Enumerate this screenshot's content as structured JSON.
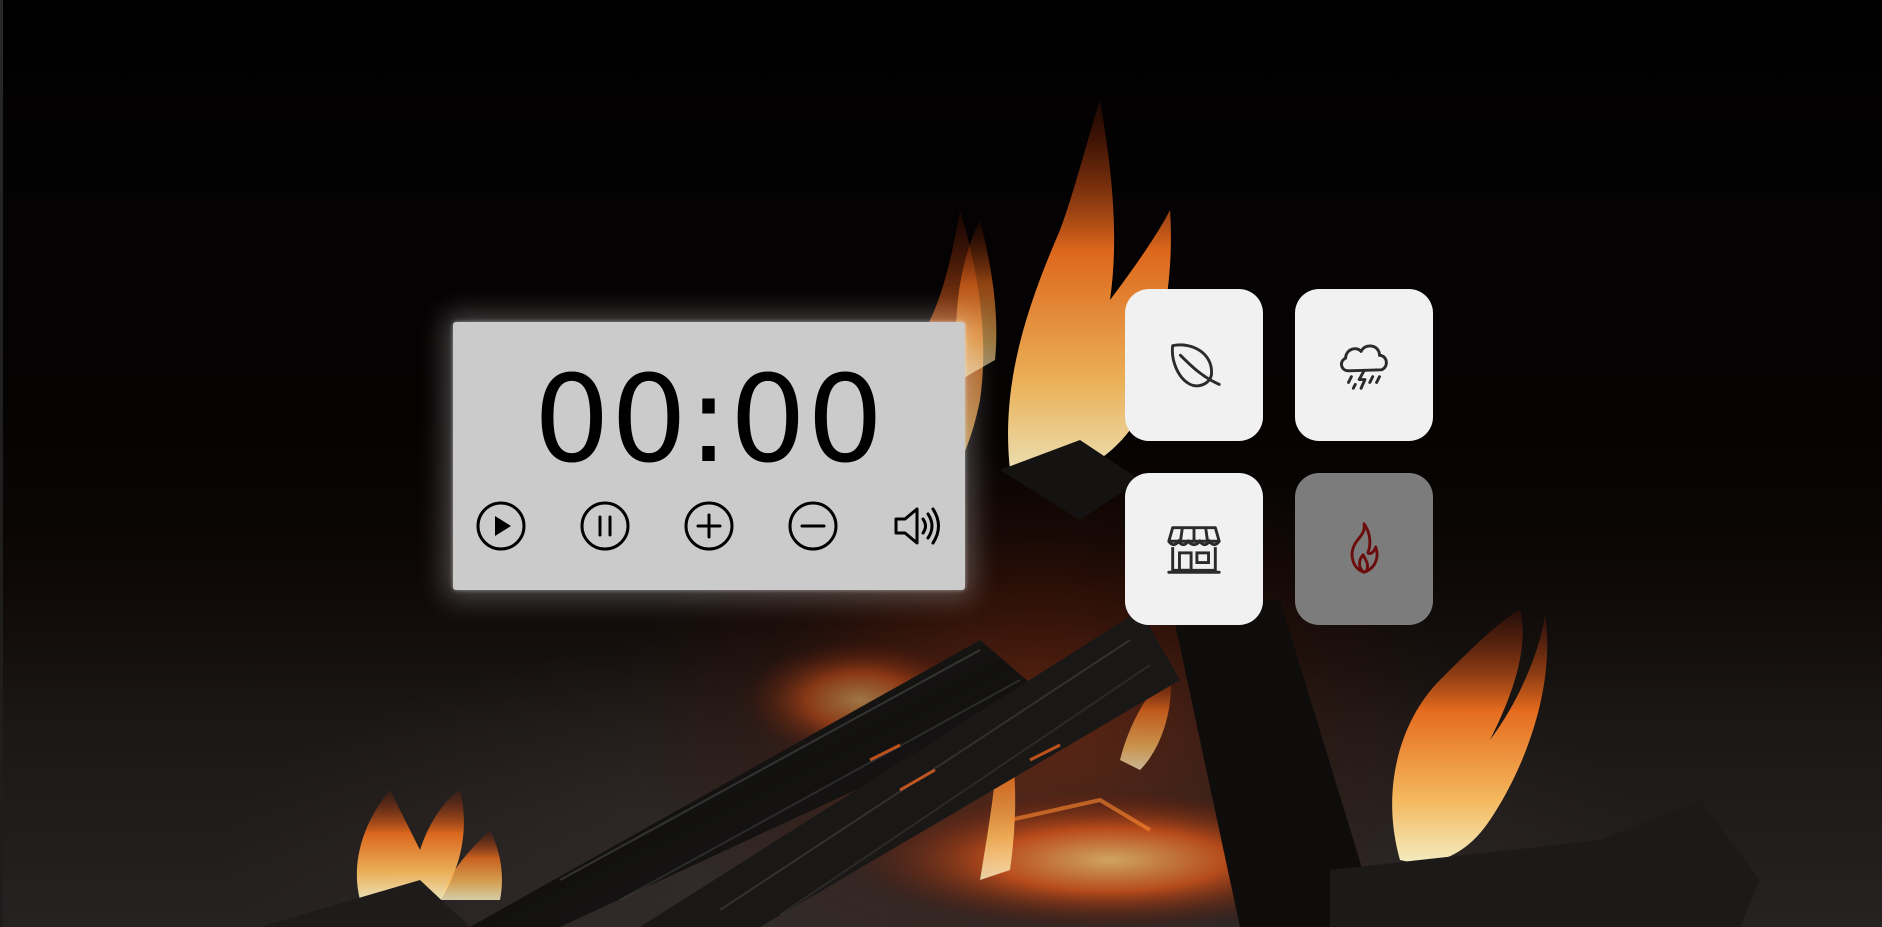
{
  "timer": {
    "display": "00:00"
  },
  "controls": {
    "play_icon": "play-circle-icon",
    "pause_icon": "pause-circle-icon",
    "increase_icon": "plus-circle-icon",
    "decrease_icon": "minus-circle-icon",
    "volume_icon": "speaker-volume-icon"
  },
  "sounds": [
    {
      "icon": "leaf-icon",
      "active": false
    },
    {
      "icon": "thunderstorm-icon",
      "active": false
    },
    {
      "icon": "store-icon",
      "active": false
    },
    {
      "icon": "fire-icon",
      "active": true
    }
  ],
  "colors": {
    "panel_background": "#cbcbcb",
    "tile_background": "#f1f1f1",
    "tile_active_background": "#7c7c7c",
    "fire_icon_color": "#6b0d0d",
    "icon_color": "#2b2b2b"
  }
}
